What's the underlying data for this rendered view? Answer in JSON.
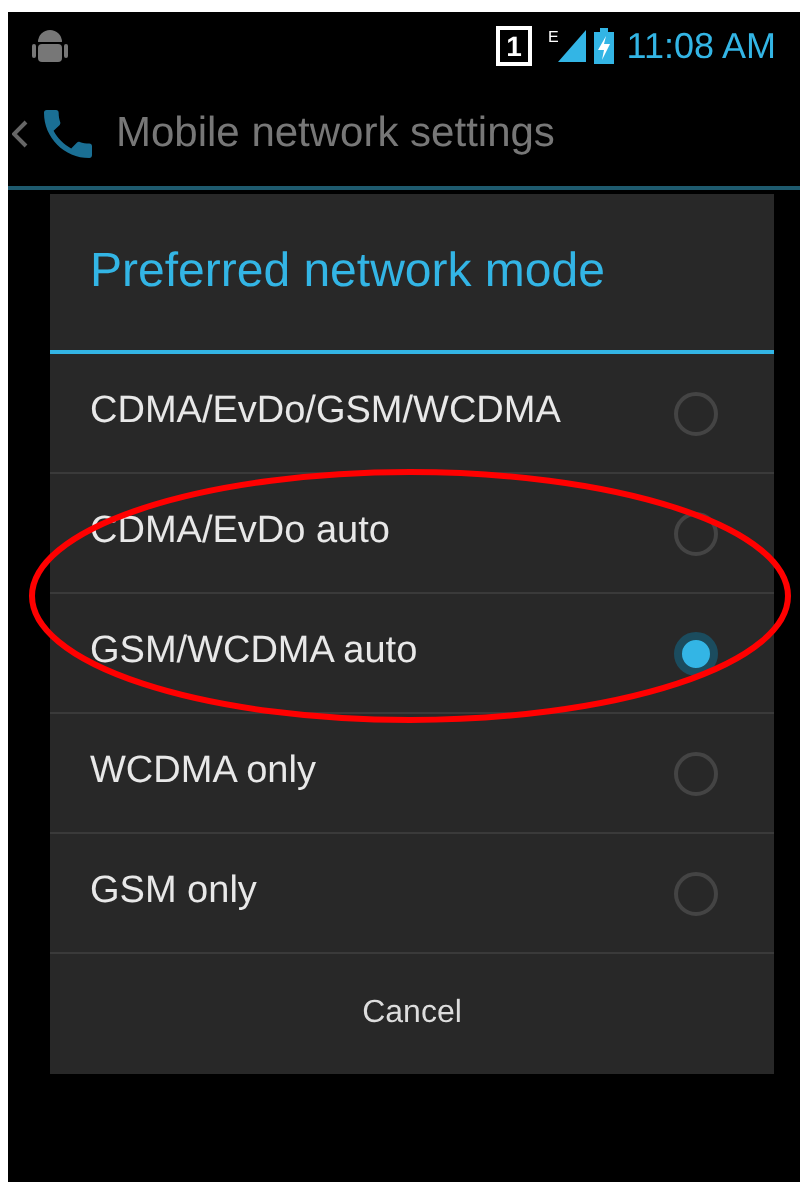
{
  "status_bar": {
    "sim_slot": "1",
    "network_type": "E",
    "time": "11:08 AM"
  },
  "action_bar": {
    "title": "Mobile network settings"
  },
  "dialog": {
    "title": "Preferred network mode",
    "options": [
      {
        "label": "CDMA/EvDo/GSM/WCDMA",
        "selected": false
      },
      {
        "label": "CDMA/EvDo auto",
        "selected": false
      },
      {
        "label": "GSM/WCDMA auto",
        "selected": true
      },
      {
        "label": "WCDMA only",
        "selected": false
      },
      {
        "label": "GSM only",
        "selected": false
      }
    ],
    "cancel": "Cancel"
  }
}
